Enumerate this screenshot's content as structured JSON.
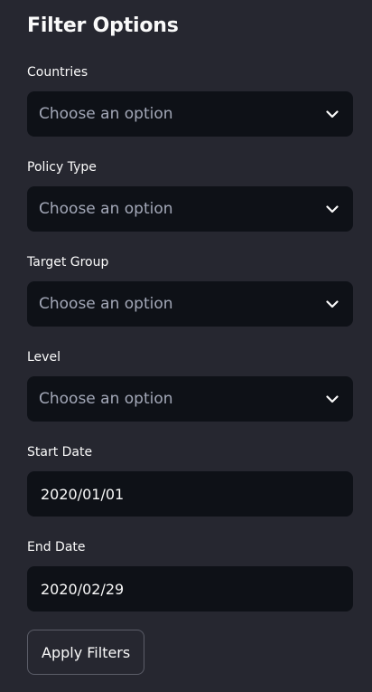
{
  "sidebar": {
    "title": "Filter Options",
    "filters": [
      {
        "label": "Countries",
        "placeholder": "Choose an option",
        "icon": "chevron-down-icon"
      },
      {
        "label": "Policy Type",
        "placeholder": "Choose an option",
        "icon": "chevron-down-icon"
      },
      {
        "label": "Target Group",
        "placeholder": "Choose an option",
        "icon": "chevron-down-icon"
      },
      {
        "label": "Level",
        "placeholder": "Choose an option",
        "icon": "chevron-down-icon"
      }
    ],
    "start_date": {
      "label": "Start Date",
      "value": "2020/01/01"
    },
    "end_date": {
      "label": "End Date",
      "value": "2020/02/29"
    },
    "apply_button": "Apply Filters"
  },
  "colors": {
    "background": "#262730",
    "input_background": "#0e1117",
    "text": "#fafafa",
    "placeholder": "#a3a8b8",
    "button_border": "#5b5d68"
  }
}
